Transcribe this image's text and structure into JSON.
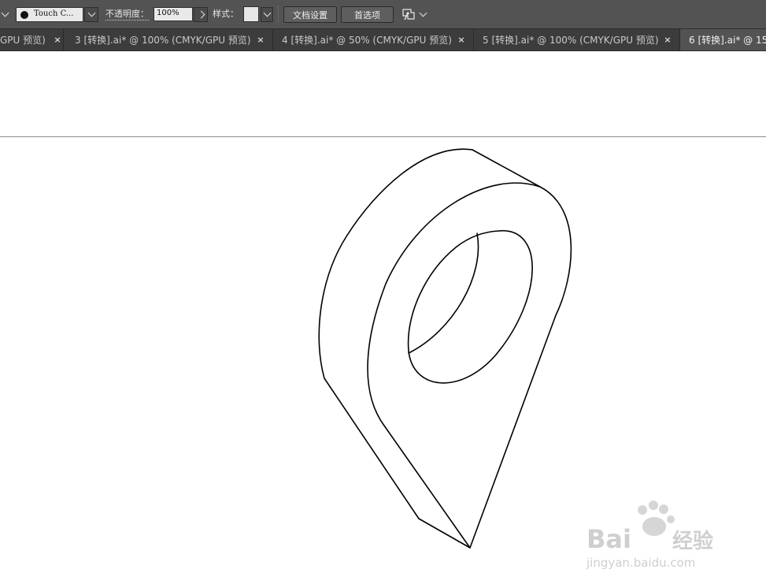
{
  "toolbar": {
    "brush_name": "Touch C...",
    "opacity_label": "不透明度：",
    "opacity_value": "100%",
    "style_label": "样式：",
    "style_swatch_color": "#e6e6e6",
    "doc_setup_label": "文档设置",
    "preferences_label": "首选项",
    "puppet_icon": "puppet-warp-icon"
  },
  "tabs": [
    {
      "label": "GPU 预览)",
      "close": "×",
      "active": false
    },
    {
      "label": "3 [转换].ai* @ 100% (CMYK/GPU 预览)",
      "close": "×",
      "active": false
    },
    {
      "label": "4 [转换].ai* @ 50% (CMYK/GPU 预览)",
      "close": "×",
      "active": false
    },
    {
      "label": "5 [转换].ai* @ 100% (CMYK/GPU 预览)",
      "close": "×",
      "active": false
    },
    {
      "label": "6 [转换].ai* @ 15",
      "close": "",
      "active": true
    }
  ],
  "watermark": {
    "brand": "Bai",
    "brand_suffix": "经验",
    "url": "jingyan.baidu.com"
  },
  "colors": {
    "toolbar_bg": "#535353",
    "tabbar_bg": "#3c3c3c",
    "canvas_bg": "#ffffff",
    "stroke": "#000000"
  }
}
